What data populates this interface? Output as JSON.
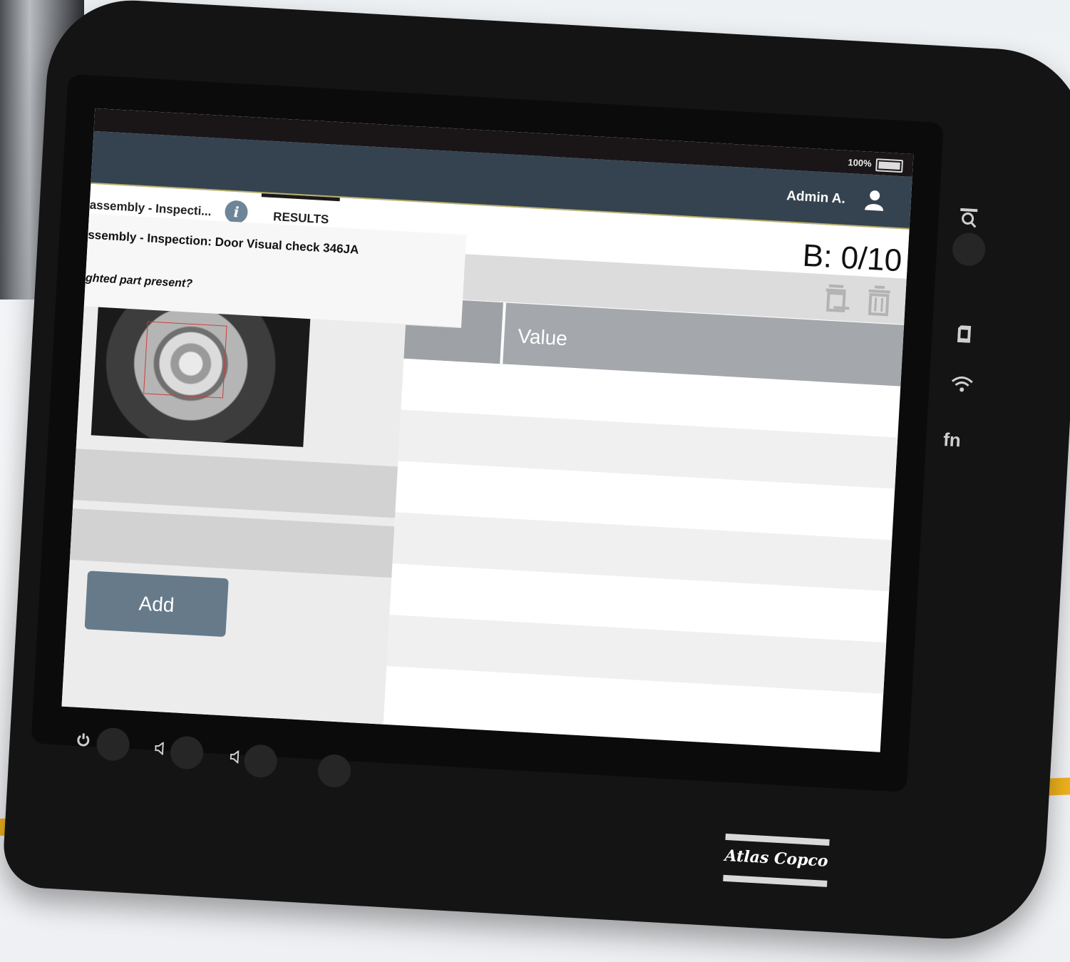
{
  "status": {
    "battery": "100%"
  },
  "header": {
    "user_name": "Admin A."
  },
  "tabs": {
    "current": "assembly - Inspecti...",
    "results": "RESULTS"
  },
  "counter": "B: 0/10",
  "panel": {
    "title": "ssembly - Inspection: Door Visual check 346JA",
    "question": "ghted part present?",
    "add_label": "Add"
  },
  "grid": {
    "value_header": "Value"
  },
  "hardware": {
    "fn_label": "fn"
  },
  "brand": {
    "logo_text": "Atlas Copco"
  },
  "icons": [
    "battery-icon",
    "user-icon",
    "info-icon",
    "delete-all-icon",
    "delete-icon",
    "scan-icon",
    "sd-card-icon",
    "wifi-icon",
    "power-icon",
    "volume-down-icon",
    "volume-up-icon"
  ],
  "colors": {
    "appbar": "#354350",
    "accent": "#f1b41c",
    "add_button": "#667a8a",
    "grid_header": "#a4a8ac"
  }
}
